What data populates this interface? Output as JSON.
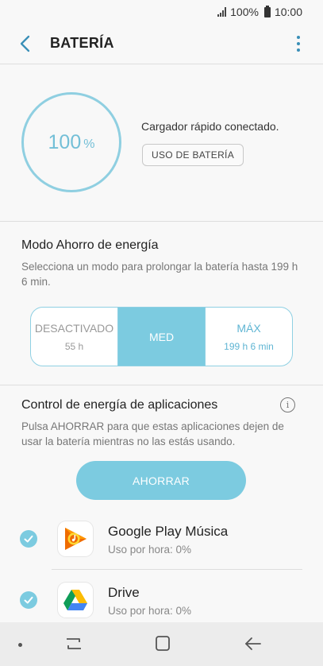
{
  "status_bar": {
    "battery_percent": "100%",
    "time": "10:00"
  },
  "app_bar": {
    "title": "BATERÍA"
  },
  "battery": {
    "level_value": "100",
    "level_unit": "%",
    "charger_status": "Cargador rápido conectado.",
    "usage_button": "USO DE BATERÍA"
  },
  "power_mode": {
    "title": "Modo Ahorro de energía",
    "description": "Selecciona un modo para prolongar la batería hasta 199 h 6 min.",
    "options": [
      {
        "name": "DESACTIVADO",
        "time": "55 h",
        "selected": false
      },
      {
        "name": "MED",
        "time": "",
        "selected": true
      },
      {
        "name": "MÁX",
        "time": "199 h 6 min",
        "selected": false
      }
    ]
  },
  "app_power": {
    "title": "Control de energía de aplicaciones",
    "info_icon": "i",
    "description": "Pulsa AHORRAR para que estas aplicaciones dejen de usar la batería mientras no las estás usando.",
    "save_button": "AHORRAR",
    "apps": [
      {
        "name": "Google Play Música",
        "usage": "Uso por hora: 0%",
        "checked": true
      },
      {
        "name": "Drive",
        "usage": "Uso por hora: 0%",
        "checked": true
      }
    ]
  },
  "nav_bar": {
    "icons": [
      "recents-icon",
      "home-icon",
      "back-icon"
    ]
  },
  "colors": {
    "accent": "#7ccbe0",
    "accent_dark": "#3a8fb7",
    "background": "#f8f8f8"
  }
}
